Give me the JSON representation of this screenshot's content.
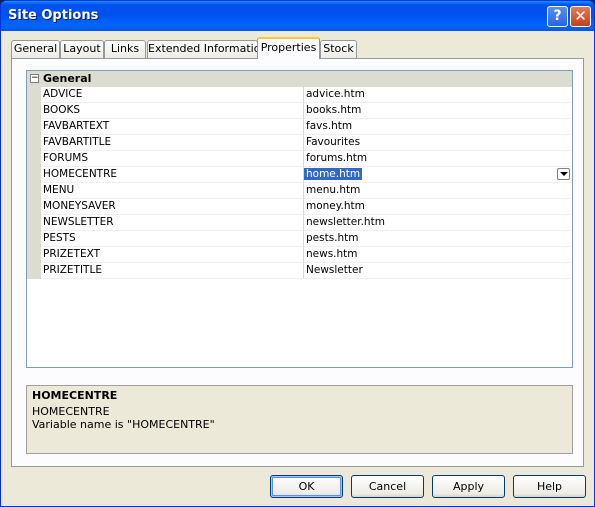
{
  "window": {
    "title": "Site Options",
    "help_glyph": "?",
    "close_glyph": "✕"
  },
  "tabs": [
    "General",
    "Layout",
    "Links",
    "Extended Information",
    "Properties",
    "Stock"
  ],
  "active_tab": "Properties",
  "grid": {
    "category": "General",
    "category_expander": "−",
    "rows": [
      {
        "name": "ADVICE",
        "value": "advice.htm"
      },
      {
        "name": "BOOKS",
        "value": "books.htm"
      },
      {
        "name": "FAVBARTEXT",
        "value": "favs.htm"
      },
      {
        "name": "FAVBARTITLE",
        "value": "Favourites"
      },
      {
        "name": "FORUMS",
        "value": "forums.htm"
      },
      {
        "name": "HOMECENTRE",
        "value": "home.htm"
      },
      {
        "name": "MENU",
        "value": "menu.htm"
      },
      {
        "name": "MONEYSAVER",
        "value": "money.htm"
      },
      {
        "name": "NEWSLETTER",
        "value": "newsletter.htm"
      },
      {
        "name": "PESTS",
        "value": "pests.htm"
      },
      {
        "name": "PRIZETEXT",
        "value": "news.htm"
      },
      {
        "name": "PRIZETITLE",
        "value": "Newsletter"
      }
    ],
    "selected_row": "HOMECENTRE"
  },
  "description": {
    "title": "HOMECENTRE",
    "line1": "HOMECENTRE",
    "line2": "Variable name is \"HOMECENTRE\""
  },
  "buttons": {
    "ok": "OK",
    "cancel": "Cancel",
    "apply": "Apply",
    "help": "Help"
  }
}
